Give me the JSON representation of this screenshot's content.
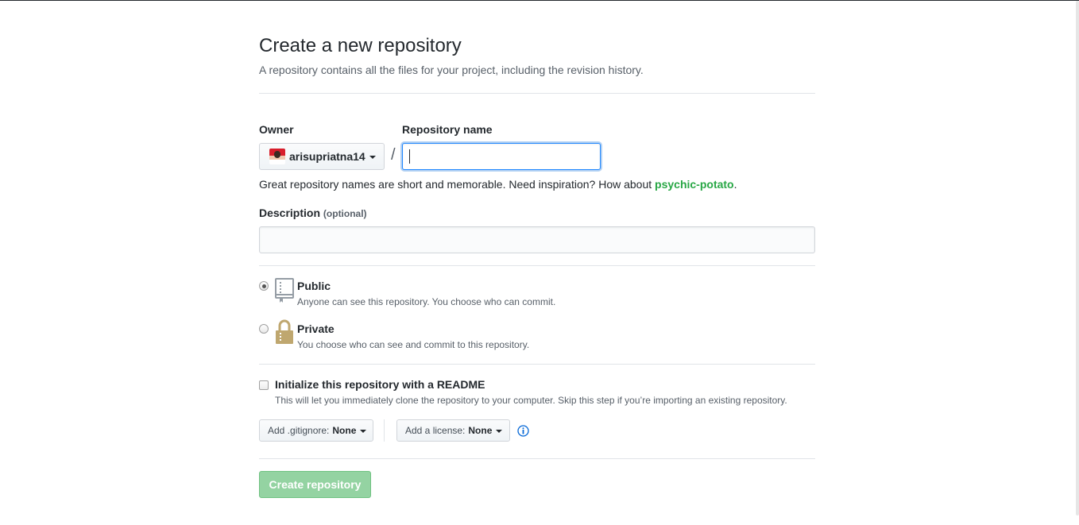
{
  "header": {
    "title": "Create a new repository",
    "subtitle": "A repository contains all the files for your project, including the revision history."
  },
  "owner": {
    "label": "Owner",
    "name": "arisupriatna14"
  },
  "separator": "/",
  "repo_name": {
    "label": "Repository name",
    "value": "",
    "hint_prefix": "Great repository names are short and memorable. Need inspiration? How about ",
    "suggestion": "psychic-potato",
    "hint_suffix": "."
  },
  "description": {
    "label": "Description",
    "note": "(optional)",
    "value": ""
  },
  "visibility": {
    "public": {
      "title": "Public",
      "desc": "Anyone can see this repository. You choose who can commit.",
      "selected": true
    },
    "private": {
      "title": "Private",
      "desc": "You choose who can see and commit to this repository.",
      "selected": false
    }
  },
  "readme": {
    "title": "Initialize this repository with a README",
    "desc": "This will let you immediately clone the repository to your computer. Skip this step if you’re importing an existing repository.",
    "checked": false
  },
  "gitignore": {
    "prefix": "Add .gitignore:",
    "value": "None"
  },
  "license": {
    "prefix": "Add a license:",
    "value": "None"
  },
  "submit": {
    "label": "Create repository",
    "disabled": true
  },
  "colors": {
    "suggestion_green": "#28a745",
    "create_button_disabled": "#94d3a2",
    "input_focus": "#2188ff"
  },
  "icons": [
    "repo-icon",
    "lock-icon",
    "info-icon",
    "chevron-down-icon"
  ]
}
